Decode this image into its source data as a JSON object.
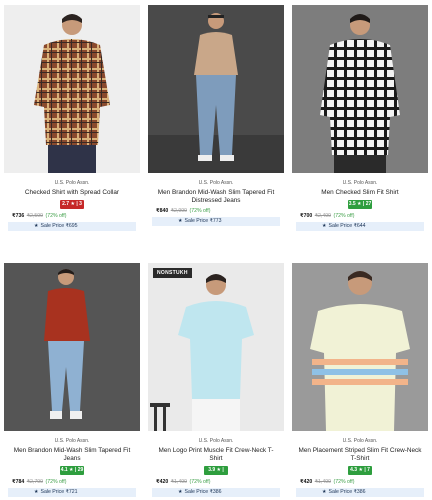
{
  "products": [
    {
      "brand": "U.S. Polo Assn.",
      "title": "Checked Shirt with Spread Collar",
      "rating": "2.7 ★ | 3",
      "rating_color": "red",
      "price": "₹736",
      "mrp": "₹2,599",
      "discount": "(72% off)",
      "sale_label": "Sale Price ₹695",
      "tag": ""
    },
    {
      "brand": "U.S. Polo Assn.",
      "title": "Men Brandon Mid-Wash Slim Tapered Fit Distressed Jeans",
      "rating": "",
      "rating_color": "",
      "price": "₹840",
      "mrp": "₹2,999",
      "discount": "(72% off)",
      "sale_label": "Sale Price ₹773",
      "tag": ""
    },
    {
      "brand": "U.S. Polo Assn.",
      "title": "Men Checked Slim Fit Shirt",
      "rating": "3.5 ★ | 27",
      "rating_color": "green",
      "price": "₹700",
      "mrp": "₹2,499",
      "discount": "(72% off)",
      "sale_label": "Sale Price ₹644",
      "tag": ""
    },
    {
      "brand": "U.S. Polo Assn.",
      "title": "Men Brandon Mid-Wash Slim Tapered Fit Jeans",
      "rating": "4.1 ★ | 29",
      "rating_color": "green",
      "price": "₹784",
      "mrp": "₹2,799",
      "discount": "(72% off)",
      "sale_label": "Sale Price ₹721",
      "tag": ""
    },
    {
      "brand": "U.S. Polo Assn.",
      "title": "Men Logo Print Muscle Fit Crew-Neck T-Shirt",
      "rating": "3.9 ★ | 129",
      "rating_color": "green",
      "price": "₹420",
      "mrp": "₹1,499",
      "discount": "(72% off)",
      "sale_label": "Sale Price ₹386",
      "tag": "NONSTUKH"
    },
    {
      "brand": "U.S. Polo Assn.",
      "title": "Men Placement Striped Slim Fit Crew-Neck T-Shirt",
      "rating": "4.3 ★ | 7",
      "rating_color": "green",
      "price": "₹420",
      "mrp": "₹1,499",
      "discount": "(72% off)",
      "sale_label": "Sale Price ₹386",
      "tag": ""
    }
  ]
}
